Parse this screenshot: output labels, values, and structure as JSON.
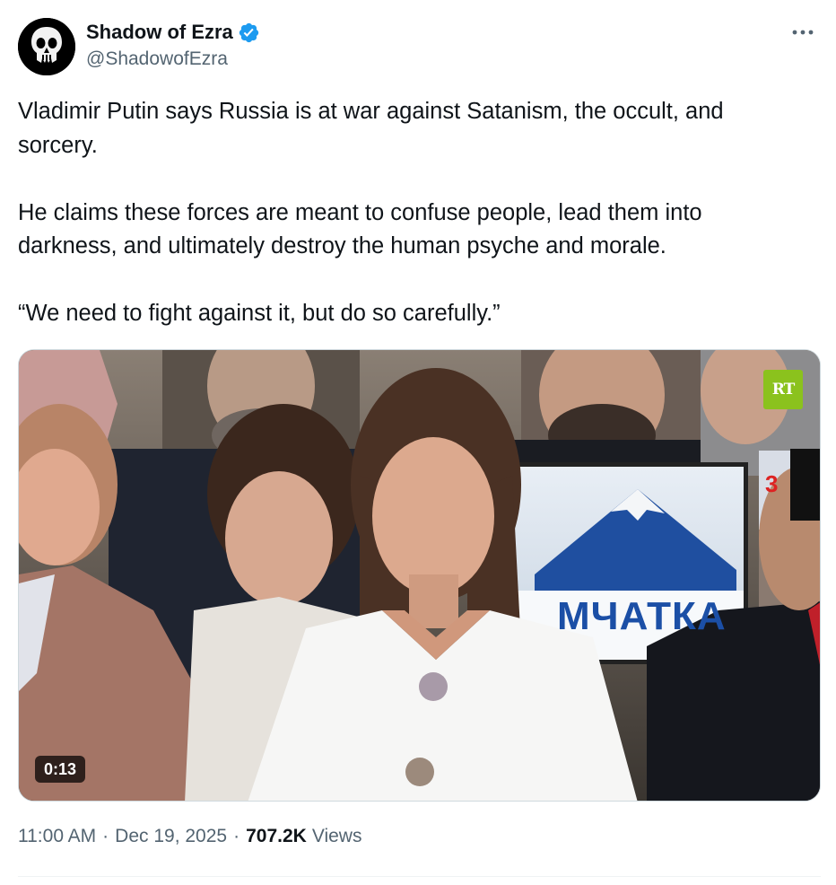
{
  "author": {
    "display_name": "Shadow of Ezra",
    "handle": "@ShadowofEzra",
    "verified": true,
    "avatar_icon": "skull-avatar-icon",
    "verified_color": "#1d9bf0"
  },
  "tweet": {
    "paragraphs": [
      "Vladimir Putin says Russia is at war against Satanism, the occult, and sorcery.",
      "He claims these forces are meant to confuse people, lead them into darkness, and ultimately destroy the human psyche and morale.",
      "“We need to fight against it, but do so carefully.”"
    ]
  },
  "media": {
    "type": "video",
    "duration": "0:13",
    "watermark": "RT",
    "sign_text": "МЧАТКА",
    "sign_partial": "3"
  },
  "meta": {
    "time": "11:00 AM",
    "date": "Dec 19, 2025",
    "separator": "·",
    "views_count": "707.2K",
    "views_label": "Views"
  },
  "icons": {
    "more": "more-options-icon",
    "verified": "verified-badge-icon"
  }
}
